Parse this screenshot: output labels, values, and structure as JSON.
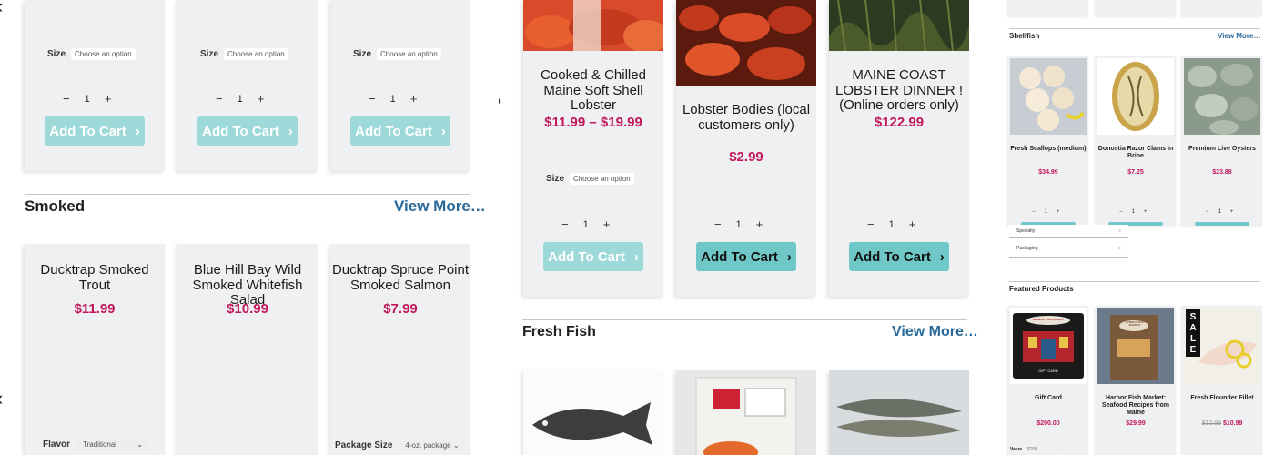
{
  "panel1": {
    "top_cards": [
      {
        "size_label": "Size",
        "size_select": "Choose an option",
        "qty": "1",
        "cart_label": "Add To Cart"
      },
      {
        "size_label": "Size",
        "size_select": "Choose an option",
        "qty": "1",
        "cart_label": "Add To Cart"
      },
      {
        "size_label": "Size",
        "size_select": "Choose an option",
        "qty": "1",
        "cart_label": "Add To Cart"
      }
    ],
    "section": {
      "title": "Smoked",
      "view_more": "View More…"
    },
    "products": [
      {
        "name": "Ducktrap Smoked Trout",
        "price": "$11.99",
        "option_label": "Flavor",
        "option_value": "Traditional"
      },
      {
        "name": "Blue Hill Bay Wild Smoked Whitefish Salad",
        "price": "$10.99"
      },
      {
        "name": "Ducktrap Spruce Point Smoked Salmon",
        "price": "$7.99",
        "option_label": "Package Size",
        "option_value": "4-oz. package"
      }
    ]
  },
  "panel2": {
    "products": [
      {
        "name": "Cooked & Chilled Maine Soft Shell Lobster",
        "price": "$11.99 – $19.99",
        "size_label": "Size",
        "size_select": "Choose an option",
        "qty": "1",
        "cart_label": "Add To Cart"
      },
      {
        "name": "Lobster Bodies (local customers only)",
        "price": "$2.99",
        "qty": "1",
        "cart_label": "Add To Cart"
      },
      {
        "name": "MAINE COAST LOBSTER DINNER ! (Online orders only)",
        "price": "$122.99",
        "qty": "1",
        "cart_label": "Add To Cart"
      }
    ],
    "section": {
      "title": "Fresh Fish",
      "view_more": "View More…"
    }
  },
  "panel3": {
    "shellfish": {
      "title": "Shellfish",
      "view_more": "View More…"
    },
    "shellfish_products": [
      {
        "name": "Fresh Scallops (medium)",
        "price": "$34.99",
        "qty": "1"
      },
      {
        "name": "Donostia Razor Clams in Brine",
        "price": "$7.25",
        "qty": "1"
      },
      {
        "name": "Premium Live Oysters",
        "price": "$23.88",
        "qty": "1"
      }
    ],
    "filters": [
      "Specialty",
      "Packaging"
    ],
    "featured": {
      "title": "Featured Products"
    },
    "featured_products": [
      {
        "name": "Gift Card",
        "price": "$200.00",
        "option_label": "Value",
        "option_value": "$200"
      },
      {
        "name": "Harbor Fish Market: Seafood Recipes from Maine",
        "price": "$29.99"
      },
      {
        "name": "Fresh Flounder Fillet",
        "old_price": "$12.99",
        "price": "$10.99"
      }
    ],
    "gift_card_text": {
      "brand": "HARBOR FISH MARKET",
      "caption": "GIFT CARD"
    },
    "book_text": {
      "brand": "HARBOR FISH MARKET"
    },
    "sale_text": "SALE"
  },
  "colors": {
    "accent": "#6fc7c7",
    "price": "#c2185b",
    "link": "#2a6a9a"
  }
}
